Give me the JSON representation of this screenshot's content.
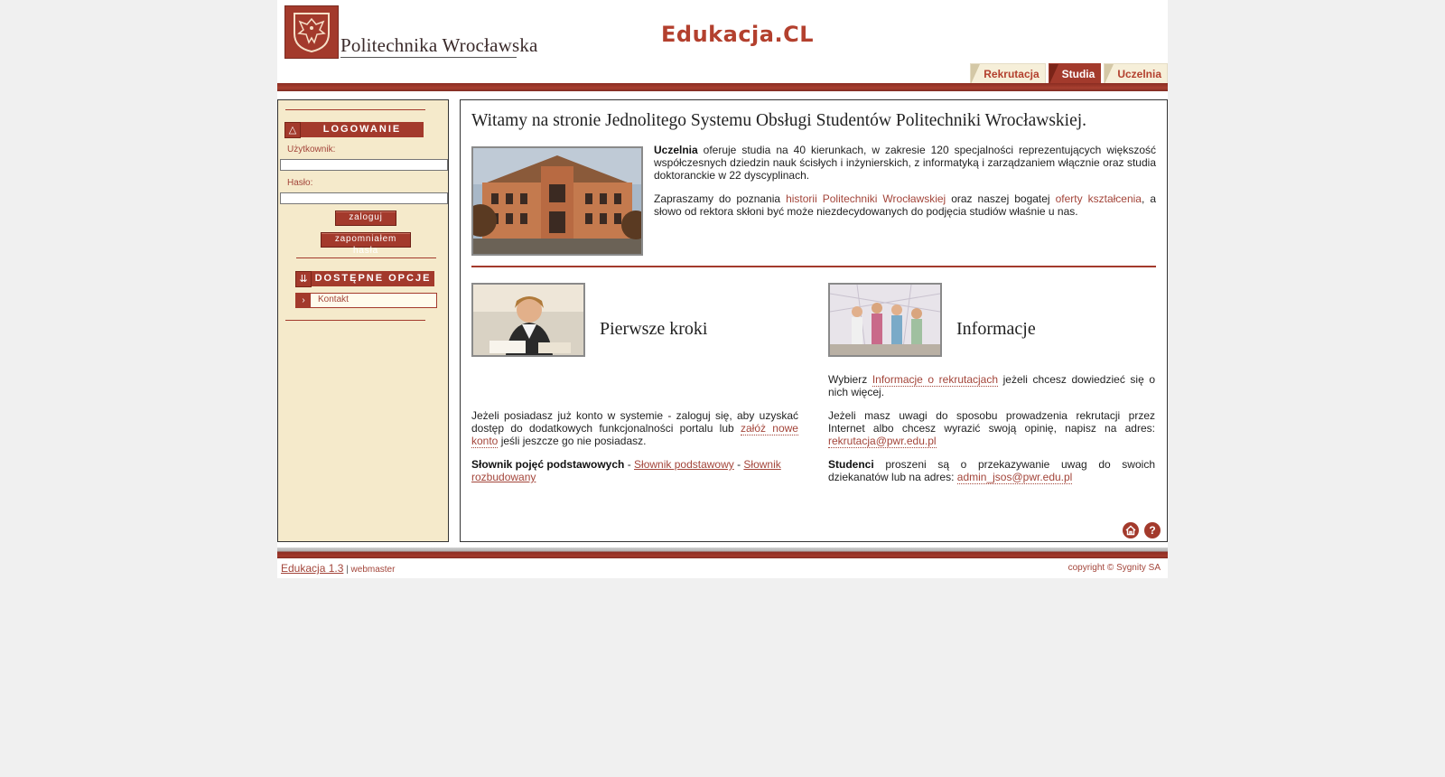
{
  "header": {
    "university_name": "Politechnika Wrocławska",
    "brand": "Edukacja.CL",
    "tabs": [
      {
        "label": "Rekrutacja",
        "active": false
      },
      {
        "label": "Studia",
        "active": true
      },
      {
        "label": "Uczelnia",
        "active": false
      }
    ]
  },
  "sidebar": {
    "login_header": "LOGOWANIE",
    "login_icon": "user-icon",
    "username_label": "Użytkownik:",
    "username_value": "",
    "password_label": "Hasło:",
    "password_value": "",
    "login_button": "zaloguj",
    "forgot_button": "zapomniałem hasła",
    "options_header": "DOSTĘPNE OPCJE",
    "options_icon": "double-chevron-down-icon",
    "options": [
      {
        "label": "Kontakt",
        "icon": "chevron-right-icon"
      }
    ]
  },
  "main": {
    "welcome": "Witamy na stronie Jednolitego Systemu Obsługi Studentów Politechniki Wrocławskiej.",
    "intro": {
      "bold": "Uczelnia",
      "text": " oferuje studia na 40 kierunkach, w zakresie 120 specjalności reprezentujących większość współczesnych dziedzin nauk ścisłych i inżynierskich, z informatyką i zarządzaniem włącznie oraz studia doktoranckie w 22 dyscyplinach."
    },
    "invite": {
      "pre": "Zapraszamy do poznania ",
      "link1": "historii Politechniki Wrocławskiej",
      "mid": " oraz naszej bogatej ",
      "link2": "oferty kształcenia",
      "post": ", a słowo od rektora skłoni być może niezdecydowanych do podjęcia studiów właśnie u nas."
    },
    "first_steps": {
      "title": "Pierwsze kroki",
      "p1_pre": "Jeżeli posiadasz już konto w systemie - zaloguj się, aby uzyskać dostęp do dodatkowych funkcjonalności portalu lub ",
      "p1_link": "załóż nowe konto",
      "p1_post": " jeśli jeszcze go nie posiadasz.",
      "p2_bold": "Słownik pojęć podstawowych",
      "p2_sep1": " - ",
      "p2_link1": "Słownik podstawowy",
      "p2_sep2": " - ",
      "p2_link2": "Słownik rozbudowany"
    },
    "info": {
      "title": "Informacje",
      "p1_pre": "Wybierz ",
      "p1_link": "Informacje o rekrutacjach",
      "p1_post": " jeżeli chcesz dowiedzieć się o nich więcej.",
      "p2_pre": "Jeżeli masz uwagi do sposobu prowadzenia rekrutacji przez Internet albo chcesz wyrazić swoją opinię, napisz na adres: ",
      "p2_link": "rekrutacja@pwr.edu.pl",
      "p3_bold": "Studenci",
      "p3_pre": " proszeni są o przekazywanie uwag do swoich dziekanatów lub na adres: ",
      "p3_link": "admin_jsos@pwr.edu.pl"
    },
    "bottom_icons": [
      "home-icon",
      "help-icon"
    ],
    "help_glyph": "?"
  },
  "footer": {
    "app_link": "Edukacja 1.3",
    "separator": " | ",
    "webmaster": "webmaster",
    "copyright": "copyright © Sygnity SA"
  },
  "colors": {
    "accent": "#a33a2c",
    "link": "#a3453a",
    "sidebar_bg": "#f5eacb",
    "page_bg": "#f0f0f0"
  }
}
